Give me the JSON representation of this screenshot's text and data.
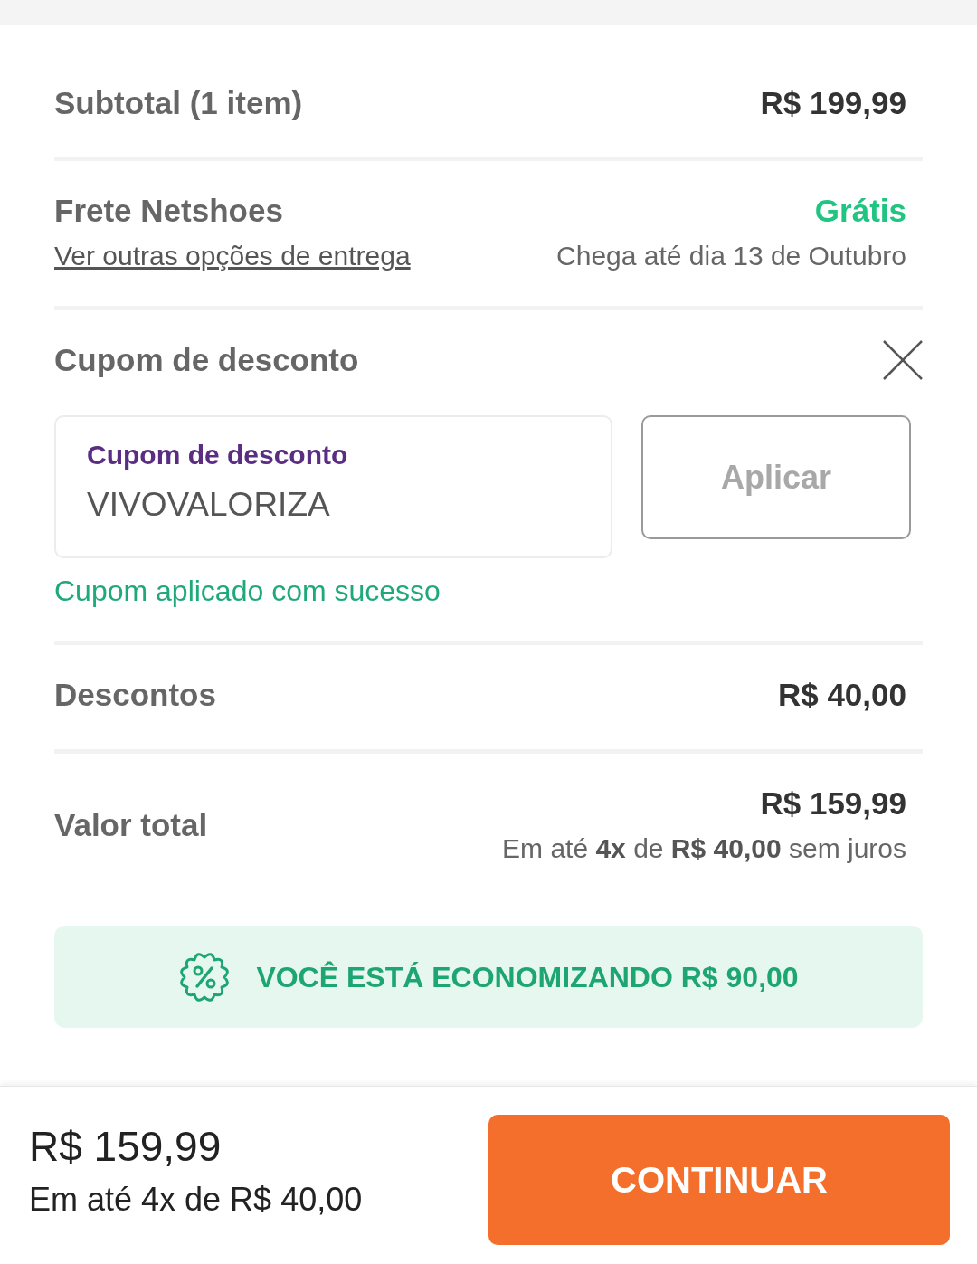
{
  "subtotal": {
    "label": "Subtotal (1 item)",
    "value": "R$ 199,99"
  },
  "shipping": {
    "label": "Frete Netshoes",
    "link": "Ver outras opções de entrega",
    "price": "Grátis",
    "delivery": "Chega até dia 13 de Outubro"
  },
  "coupon": {
    "title": "Cupom de desconto",
    "field": {
      "label": "Cupom de desconto",
      "value": "VIVOVALORIZA"
    },
    "apply_button": {
      "label": "Aplicar",
      "disabled": true
    },
    "message": "Cupom aplicado com sucesso"
  },
  "discounts": {
    "label": "Descontos",
    "value": "R$ 40,00"
  },
  "total": {
    "label": "Valor total",
    "value": "R$ 159,99",
    "installments": "Em até **4x** de **R$ 40,00** sem juros"
  },
  "savings_banner": {
    "text": "VOCÊ ESTÁ ECONOMIZANDO R$ 90,00"
  },
  "bottom_bar": {
    "price": "R$ 159,99",
    "installments": "Em até 4x de R$ 40,00",
    "button": "CONTINUAR"
  }
}
